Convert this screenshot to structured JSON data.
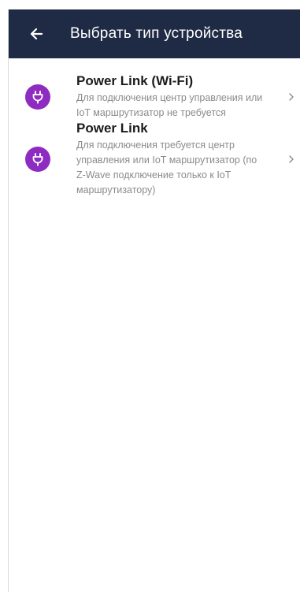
{
  "header": {
    "title": "Выбрать тип устройства",
    "back_icon": "arrow-left-icon"
  },
  "items": [
    {
      "title": "Power Link (Wi-Fi)",
      "description": "Для подключения центр управления или IoT маршрутизатор не требуется",
      "icon": "plug-icon",
      "icon_color": "#8e2bc1"
    },
    {
      "title": "Power Link",
      "description": "Для подключения требуется центр управления или IoT маршрутизатор (по Z-Wave подключение только к IoT маршрутизатору)",
      "icon": "plug-icon",
      "icon_color": "#8e2bc1"
    }
  ],
  "colors": {
    "app_bar": "#1f2a44",
    "accent": "#8e2bc1"
  }
}
